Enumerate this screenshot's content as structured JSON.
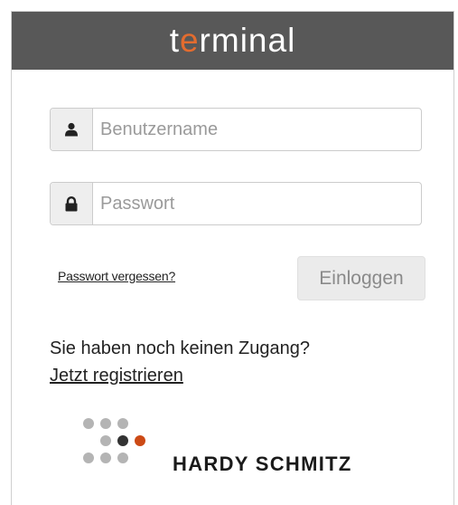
{
  "header": {
    "brand_prefix": "t",
    "brand_accent": "e",
    "brand_suffix": "rminal"
  },
  "form": {
    "username_placeholder": "Benutzername",
    "username_icon": "user-icon",
    "password_placeholder": "Passwort",
    "password_icon": "lock-icon",
    "forgot_link": "Passwort vergessen?",
    "login_button": "Einloggen"
  },
  "signup": {
    "prompt": "Sie haben noch keinen Zugang?",
    "register_link": "Jetzt registrieren"
  },
  "footer": {
    "company_name": "HARDY SCHMITZ"
  },
  "colors": {
    "header_bg": "#585858",
    "brand_accent": "#e36c2f",
    "logo_accent": "#cc4a15"
  }
}
